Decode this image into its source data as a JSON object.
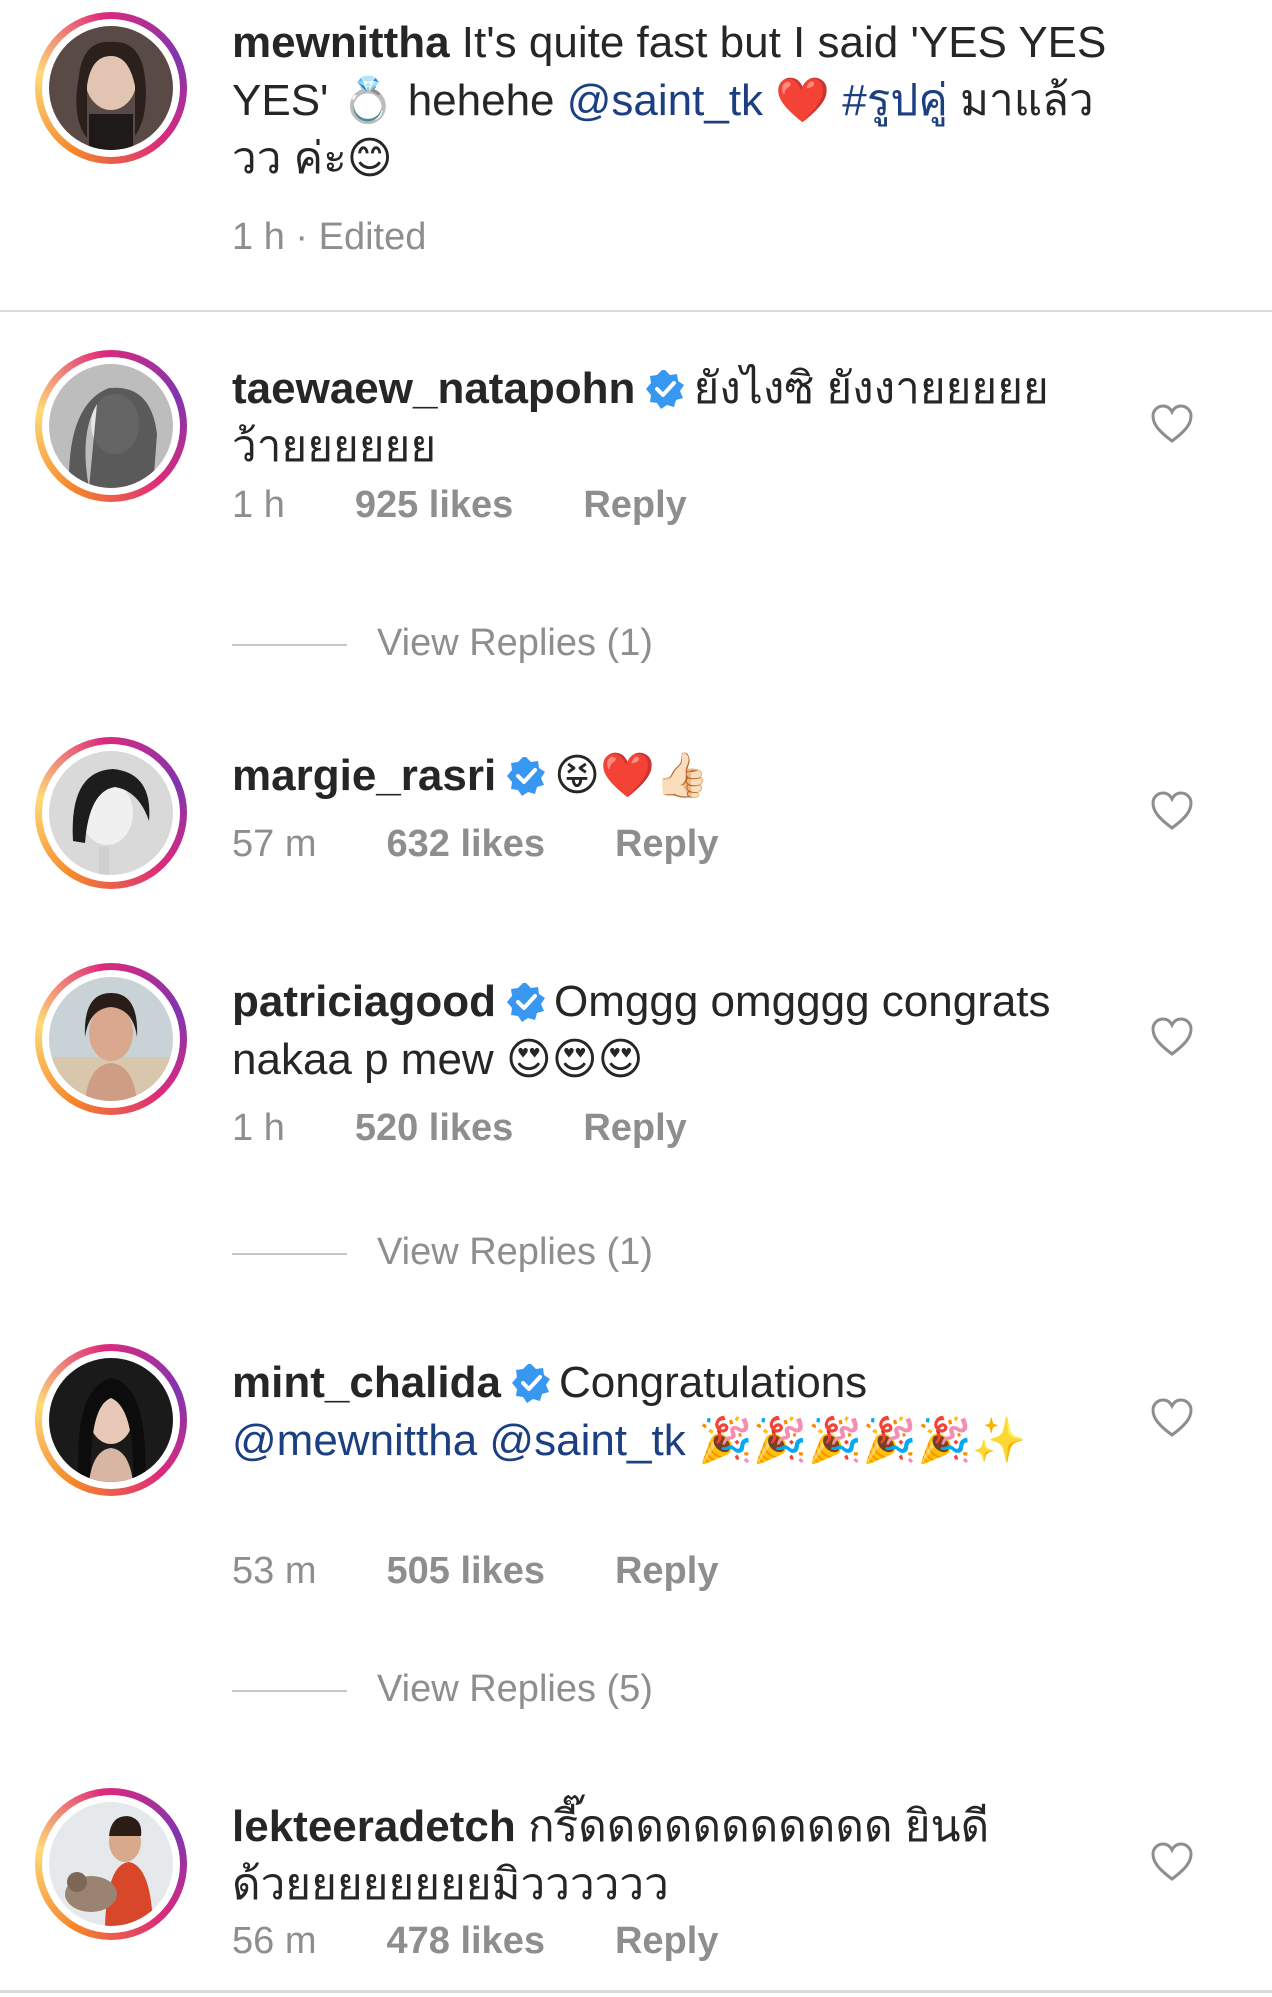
{
  "caption": {
    "username": "mewnittha",
    "text_1": " It's quite fast but I said 'YES YES YES' ",
    "ring_emoji": "💍",
    "text_2": " hehehe ",
    "mention": "@saint_tk",
    "heart_emoji": " ❤️ ",
    "hashtag": "#รูปคู่",
    "text_3": " มาแล้ววว ค่ะ",
    "smile_emoji": "😊",
    "timestamp": "1 h · Edited"
  },
  "comments": [
    {
      "username": "taewaew_natapohn",
      "text": "ยังไงซิ ยังงายยยยย ว้ายยยยยย",
      "time": "1 h",
      "likes": "925 likes",
      "reply": "Reply",
      "view_replies": "View Replies (1)"
    },
    {
      "username": "margie_rasri",
      "text": "😝❤️👍🏻",
      "time": "57 m",
      "likes": "632 likes",
      "reply": "Reply"
    },
    {
      "username": "patriciagood",
      "text": "Omggg omgggg congrats nakaa p mew 😍😍😍",
      "time": "1 h",
      "likes": "520 likes",
      "reply": "Reply",
      "view_replies": "View Replies (1)"
    },
    {
      "username": "mint_chalida",
      "text_1": "Congratulations ",
      "mention_1": "@mewnittha",
      "mention_2": "  @saint_tk",
      "text_2": " 🎉🎉🎉🎉🎉✨",
      "time": "53 m",
      "likes": "505 likes",
      "reply": "Reply",
      "view_replies": "View Replies (5)"
    },
    {
      "username": "lekteeradetch",
      "text": "กรี๊ดดดดดดดดดดด ยินดีด้วยยยยยยยยมิวววววว",
      "time": "56 m",
      "likes": "478 likes",
      "reply": "Reply"
    }
  ],
  "colors": {
    "text": "#262626",
    "meta": "#8e8e8e",
    "mention": "#1c3f82",
    "verified": "#3897f0",
    "divider": "#dbdbdb"
  }
}
